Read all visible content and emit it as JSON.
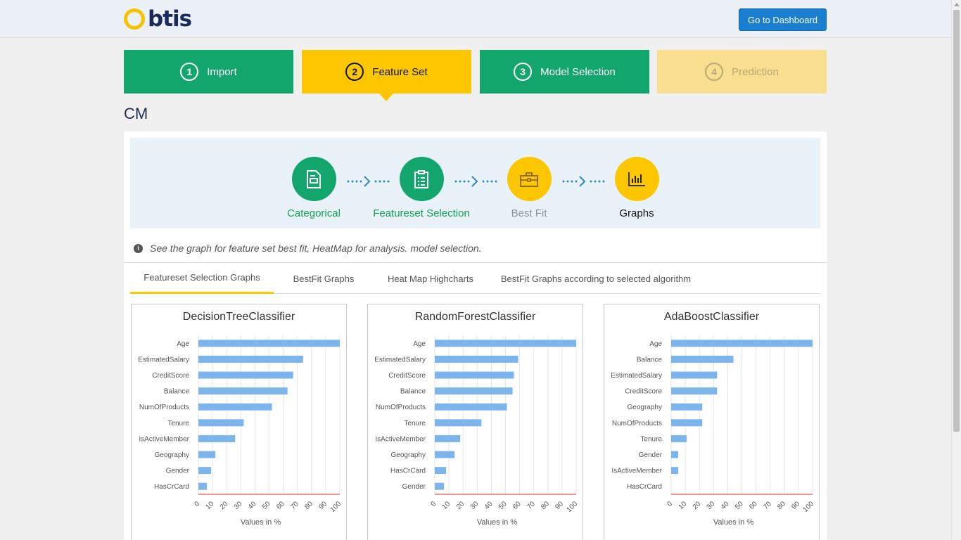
{
  "header": {
    "logo_text": "btis",
    "dashboard_button": "Go to Dashboard"
  },
  "steps": [
    {
      "num": "1",
      "label": "Import",
      "state": "done"
    },
    {
      "num": "2",
      "label": "Feature Set",
      "state": "active"
    },
    {
      "num": "3",
      "label": "Model Selection",
      "state": "done"
    },
    {
      "num": "4",
      "label": "Prediction",
      "state": "disabled"
    }
  ],
  "page_title": "CM",
  "wizard": [
    {
      "label": "Categorical",
      "icon": "document-icon",
      "state": "done"
    },
    {
      "label": "Featureset Selection",
      "icon": "checklist-icon",
      "state": "done"
    },
    {
      "label": "Best Fit",
      "icon": "briefcase-icon",
      "state": "pending"
    },
    {
      "label": "Graphs",
      "icon": "bar-chart-icon",
      "state": "active"
    }
  ],
  "info_text": "See the graph for feature set best fit, HeatMap for analysis. model selection.",
  "tabs": [
    {
      "label": "Featureset Selection Graphs",
      "active": true
    },
    {
      "label": "BestFit Graphs",
      "active": false
    },
    {
      "label": "Heat Map Highcharts",
      "active": false
    },
    {
      "label": "BestFit Graphs according to selected algorithm",
      "active": false
    }
  ],
  "colors": {
    "green": "#12a56c",
    "yellow": "#fcc600",
    "bar": "#7cb5ec",
    "axis_line": "#e03030"
  },
  "chart_data": [
    {
      "type": "bar",
      "title": "DecisionTreeClassifier",
      "xlabel": "Values in %",
      "xlim": [
        0,
        100
      ],
      "xticks": [
        0,
        10,
        20,
        30,
        40,
        50,
        60,
        70,
        80,
        90,
        100
      ],
      "categories": [
        "Age",
        "EstimatedSalary",
        "CreditScore",
        "Balance",
        "NumOfProducts",
        "Tenure",
        "IsActiveMember",
        "Geography",
        "Gender",
        "HasCrCard"
      ],
      "values": [
        100,
        74,
        67,
        63,
        52,
        32,
        26,
        12,
        9,
        6
      ]
    },
    {
      "type": "bar",
      "title": "RandomForestClassifier",
      "xlabel": "Values in %",
      "xlim": [
        0,
        100
      ],
      "xticks": [
        0,
        10,
        20,
        30,
        40,
        50,
        60,
        70,
        80,
        90,
        100
      ],
      "categories": [
        "Age",
        "EstimatedSalary",
        "CreditScore",
        "Balance",
        "NumOfProducts",
        "Tenure",
        "IsActiveMember",
        "Geography",
        "HasCrCard",
        "Gender"
      ],
      "values": [
        100,
        59,
        56,
        55,
        51,
        33,
        18,
        14,
        8,
        6.5
      ]
    },
    {
      "type": "bar",
      "title": "AdaBoostClassifier",
      "xlabel": "Values in %",
      "xlim": [
        0,
        100
      ],
      "xticks": [
        0,
        10,
        20,
        30,
        40,
        50,
        60,
        70,
        80,
        90,
        100
      ],
      "categories": [
        "Age",
        "Balance",
        "EstimatedSalary",
        "CreditScore",
        "Geography",
        "NumOfProducts",
        "Tenure",
        "Gender",
        "IsActiveMember",
        "HasCrCard"
      ],
      "values": [
        100,
        44,
        32.5,
        32.5,
        22,
        22,
        11,
        5,
        5,
        0
      ]
    }
  ]
}
